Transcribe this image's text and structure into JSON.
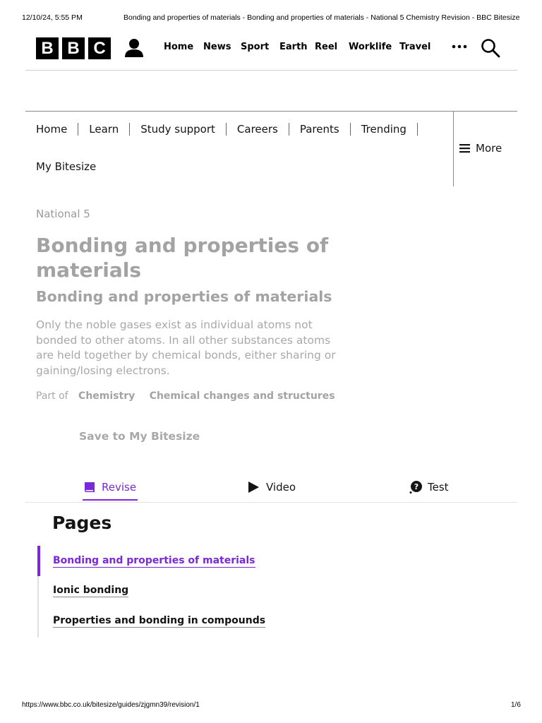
{
  "print_header": {
    "date": "12/10/24, 5:55 PM",
    "document_title": "Bonding and properties of materials - Bonding and properties of materials - National 5 Chemistry Revision - BBC Bitesize"
  },
  "masthead": {
    "logo_letters": [
      "B",
      "B",
      "C"
    ],
    "nav": [
      "Home",
      "News",
      "Sport",
      "Earth",
      "Reel",
      "Worklife",
      "Travel"
    ],
    "more_icon": "more-dots-icon",
    "search_icon": "search-icon",
    "account_icon": "account-icon"
  },
  "bitesize_nav": {
    "items": [
      "Home",
      "Learn",
      "Study support",
      "Careers",
      "Parents",
      "Trending"
    ],
    "second_row": "My Bitesize",
    "more_label": "More",
    "more_icon": "menu-icon"
  },
  "hero": {
    "level": "National 5",
    "title": "Bonding and properties of materials",
    "subtitle": "Bonding and properties of materials",
    "summary": "Only the noble gases exist as individual atoms not bonded to other atoms. In all other substances atoms are held together by chemical bonds, either sharing or gaining/losing electrons.",
    "part_of_label": "Part of",
    "crumbs": [
      "Chemistry",
      "Chemical changes and structures"
    ],
    "save_label": "Save to My Bitesize"
  },
  "tabs": [
    {
      "label": "Revise",
      "icon": "book-icon",
      "active": true
    },
    {
      "label": "Video",
      "icon": "play-icon",
      "active": false
    },
    {
      "label": "Test",
      "icon": "question-icon",
      "active": false
    }
  ],
  "pages": {
    "heading": "Pages",
    "items": [
      {
        "label": "Bonding and properties of materials",
        "current": true
      },
      {
        "label": "Ionic bonding",
        "current": false
      },
      {
        "label": "Properties and bonding in compounds",
        "current": false
      }
    ]
  },
  "colors": {
    "accent": "#7b28d8",
    "text": "#141414",
    "muted": "#a3a3a3"
  },
  "print_footer": {
    "url": "https://www.bbc.co.uk/bitesize/guides/zjgmn39/revision/1",
    "page": "1/6"
  }
}
